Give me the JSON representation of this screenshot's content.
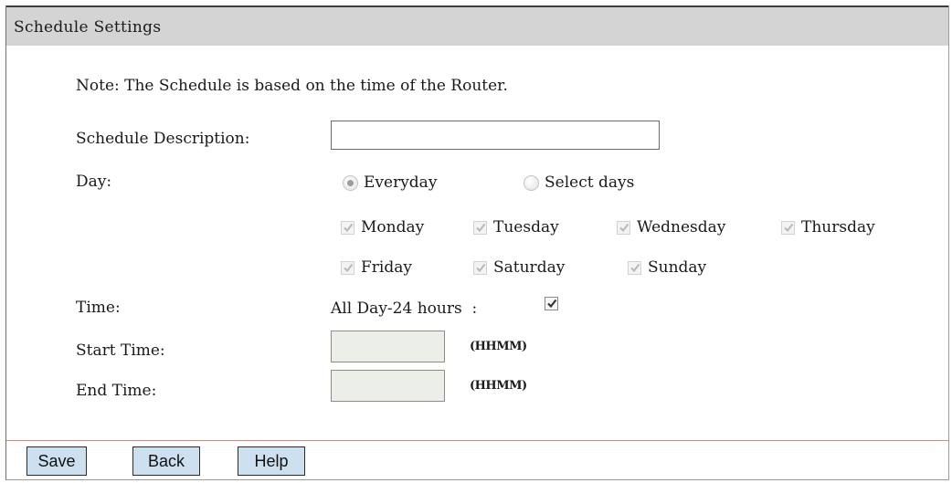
{
  "header": {
    "title": "Schedule Settings"
  },
  "note": "Note: The Schedule is based on the time of the Router.",
  "form": {
    "description_label": "Schedule Description:",
    "description_value": "",
    "day_label": "Day:",
    "day_options": [
      {
        "label": "Everyday",
        "selected": true
      },
      {
        "label": "Select days",
        "selected": false
      }
    ],
    "days": [
      {
        "label": "Monday",
        "checked": true,
        "disabled": true
      },
      {
        "label": "Tuesday",
        "checked": true,
        "disabled": true
      },
      {
        "label": "Wednesday",
        "checked": true,
        "disabled": true
      },
      {
        "label": "Thursday",
        "checked": true,
        "disabled": true
      },
      {
        "label": "Friday",
        "checked": true,
        "disabled": true
      },
      {
        "label": "Saturday",
        "checked": true,
        "disabled": true
      },
      {
        "label": "Sunday",
        "checked": true,
        "disabled": true
      }
    ],
    "time_label": "Time:",
    "all_day_label": "All Day-24 hours  :",
    "all_day_checked": true,
    "start_label": "Start Time:",
    "start_value": "",
    "end_label": "End Time:",
    "end_value": "",
    "format_hint": "(HHMM)"
  },
  "buttons": {
    "save": "Save",
    "back": "Back",
    "help": "Help"
  },
  "colors": {
    "header_bg": "#d4d4d4",
    "button_bg": "#cde0ef",
    "disabled_input_bg": "#eceee8",
    "footer_rule": "#d98a7a"
  }
}
